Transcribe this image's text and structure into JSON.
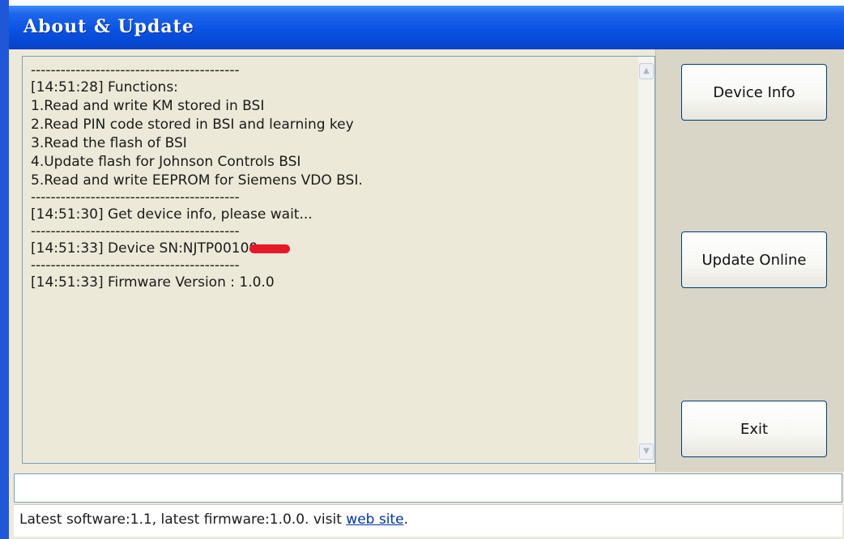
{
  "window": {
    "title": "About & Update"
  },
  "log": {
    "separator": "------------------------------------------",
    "lines": [
      "[14:51:28] Functions:",
      "1.Read and write KM stored in BSI",
      "2.Read PIN code stored in BSI and learning key",
      "3.Read the flash of BSI",
      "4.Update flash for Johnson Controls BSI",
      "5.Read and write EEPROM for Siemens VDO BSI.",
      "[14:51:30] Get device info, please wait...",
      "[14:51:33] Device SN:NJTP00100",
      "[14:51:33] Firmware Version : 1.0.0"
    ]
  },
  "buttons": {
    "device_info": "Device Info",
    "update_online": "Update Online",
    "exit": "Exit"
  },
  "input": {
    "value": ""
  },
  "status": {
    "text": "Latest software:1.1, latest firmware:1.0.0. visit ",
    "link": "web site",
    "suffix": "."
  },
  "colors": {
    "title_bar": "#0a53e2",
    "redaction": "#e5182a",
    "link": "#0033aa"
  },
  "icons": {
    "scroll_up": "chevron-up-icon",
    "scroll_down": "chevron-down-icon"
  }
}
